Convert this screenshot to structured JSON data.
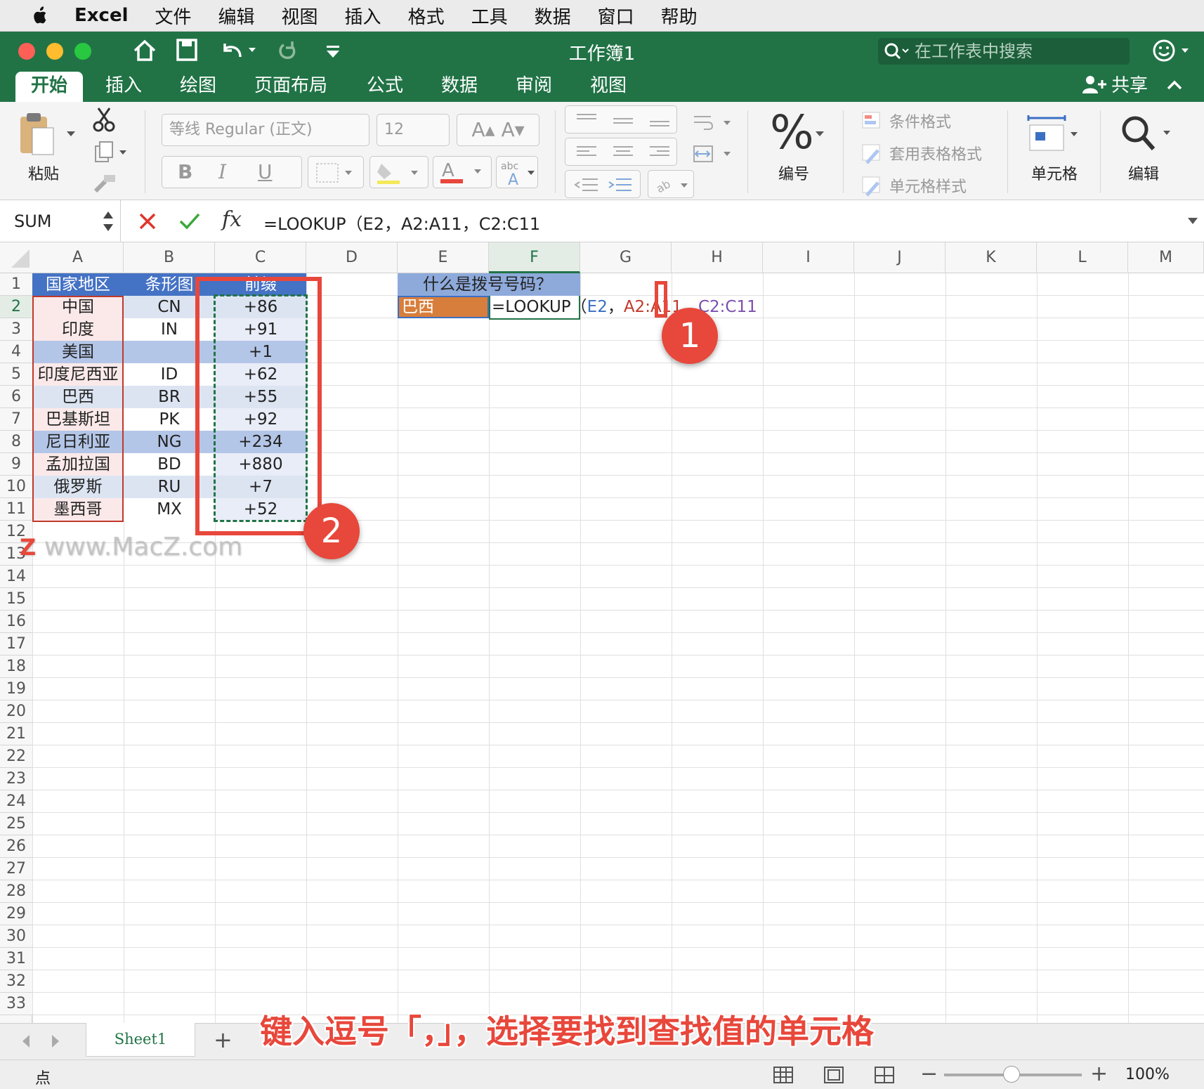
{
  "menubar": {
    "items": [
      "Excel",
      "文件",
      "编辑",
      "视图",
      "插入",
      "格式",
      "工具",
      "数据",
      "窗口",
      "帮助"
    ]
  },
  "titlebar": {
    "doc_title": "工作簿1",
    "search_placeholder": "在工作表中搜索",
    "traffic_colors": [
      "#fe5f57",
      "#febc2e",
      "#28c840"
    ]
  },
  "ribbon": {
    "tabs": [
      "开始",
      "插入",
      "绘图",
      "页面布局",
      "公式",
      "数据",
      "审阅",
      "视图"
    ],
    "share": "共享",
    "paste": "粘贴",
    "font_name": "等线 Regular (正文)",
    "font_size": "12",
    "bold": "B",
    "italic": "I",
    "underline": "U",
    "number_label": "编号",
    "number_symbol": "%",
    "conditional_format": "条件格式",
    "table_format": "套用表格格式",
    "cell_styles": "单元格样式",
    "cells": "单元格",
    "editing": "编辑"
  },
  "formulabar": {
    "namebox": "SUM",
    "fx": "fx",
    "formula": "=LOOKUP（E2，A2:A11，C2:C11"
  },
  "grid": {
    "columns": [
      "A",
      "B",
      "C",
      "D",
      "E",
      "F",
      "G",
      "H",
      "I",
      "J",
      "K",
      "L",
      "M"
    ],
    "rows": [
      "1",
      "2",
      "3",
      "4",
      "5",
      "6",
      "7",
      "8",
      "9",
      "10",
      "11",
      "12",
      "13",
      "14",
      "15",
      "16",
      "17",
      "18",
      "19",
      "20",
      "21",
      "22",
      "23",
      "24",
      "25",
      "26",
      "27",
      "28",
      "29",
      "30",
      "31",
      "32",
      "33"
    ],
    "headers": {
      "a": "国家地区",
      "b": "条形图",
      "c": "前缀"
    },
    "table": [
      {
        "country": "中国",
        "code": "CN",
        "prefix": "+86"
      },
      {
        "country": "印度",
        "code": "IN",
        "prefix": "+91"
      },
      {
        "country": "美国",
        "code": "",
        "prefix": "+1"
      },
      {
        "country": "印度尼西亚",
        "code": "ID",
        "prefix": "+62"
      },
      {
        "country": "巴西",
        "code": "BR",
        "prefix": "+55"
      },
      {
        "country": "巴基斯坦",
        "code": "PK",
        "prefix": "+92"
      },
      {
        "country": "尼日利亚",
        "code": "NG",
        "prefix": "+234"
      },
      {
        "country": "孟加拉国",
        "code": "BD",
        "prefix": "+880"
      },
      {
        "country": "俄罗斯",
        "code": "RU",
        "prefix": "+7"
      },
      {
        "country": "墨西哥",
        "code": "MX",
        "prefix": "+52"
      }
    ],
    "e1": "什么是拨号号码？",
    "e2": "巴西",
    "f2_formula": {
      "fn": "=LOOKUP（",
      "arg1": "E2",
      "sep1": "，",
      "arg2": "A2:A11",
      "sep2": "，",
      "arg3": "C2:C11"
    }
  },
  "annotations": {
    "badge1": "1",
    "badge2": "2",
    "watermark": "www.MacZ.com",
    "caption": "键入逗号「，」，选择要找到查找值的单元格"
  },
  "sheets": {
    "tab": "Sheet1",
    "add": "+"
  },
  "status": {
    "mode": "点",
    "zoom": "100%"
  }
}
